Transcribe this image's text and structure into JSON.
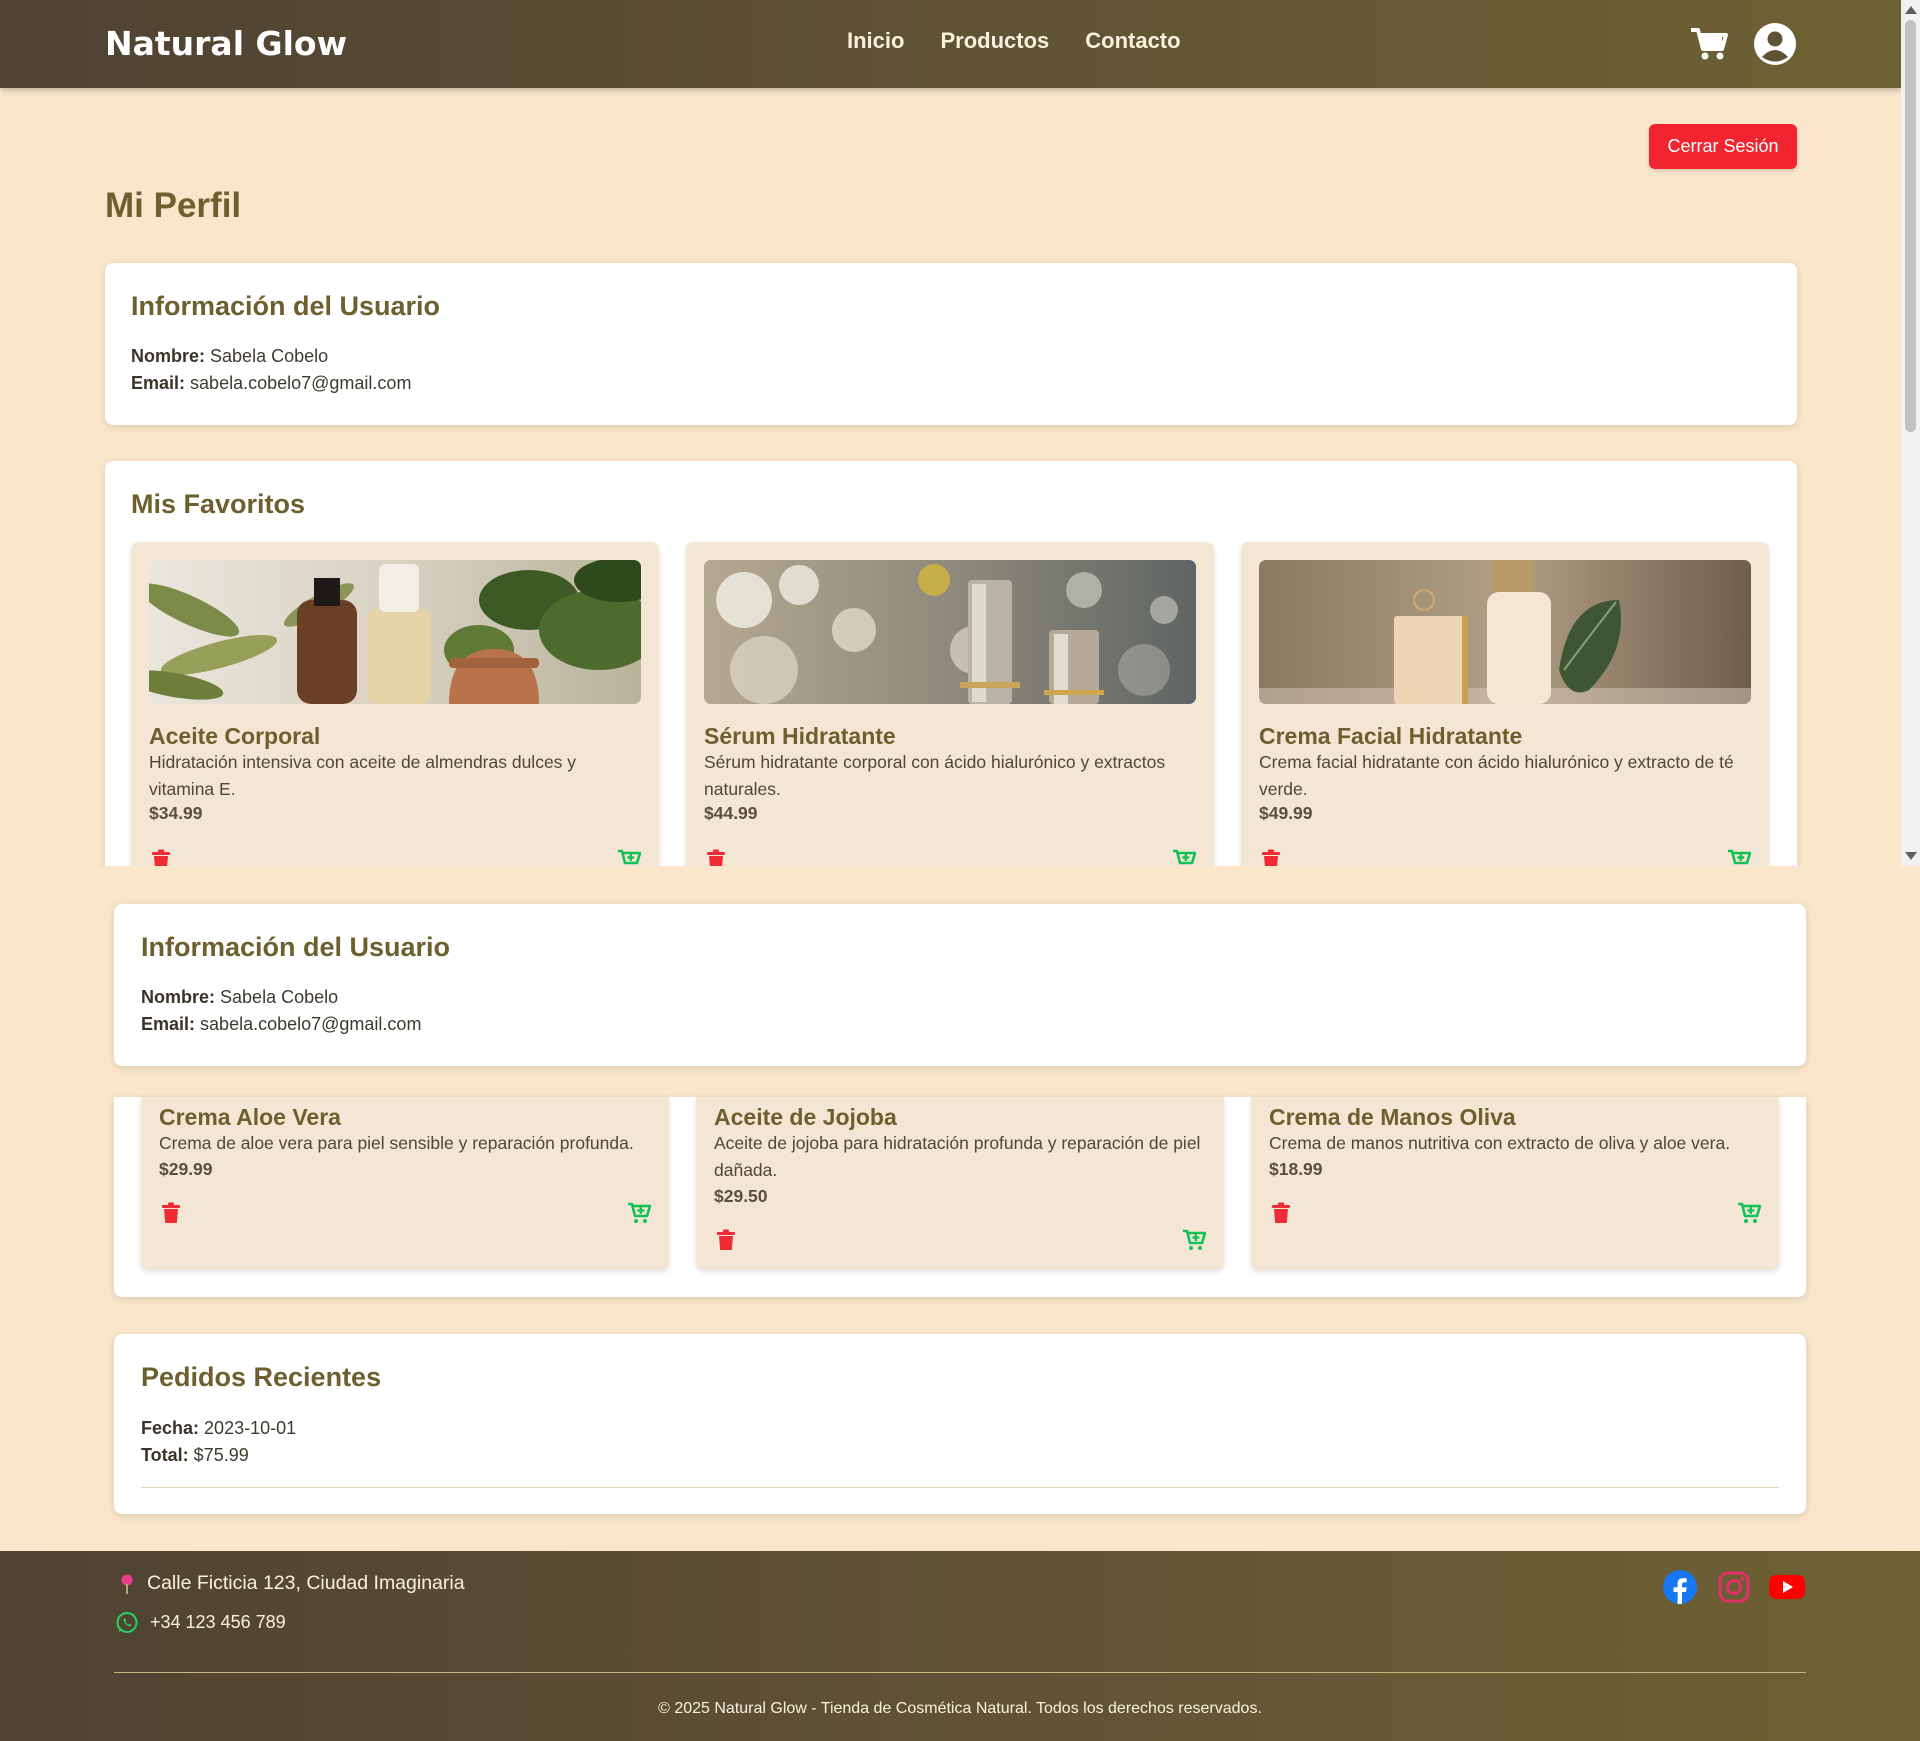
{
  "navbar": {
    "brand": "Natural Glow",
    "links": [
      "Inicio",
      "Productos",
      "Contacto"
    ],
    "icons": [
      "shopping-cart-icon",
      "user-circle-icon"
    ]
  },
  "logout_label": "Cerrar Sesión",
  "page_title": "Mi Perfil",
  "user_info": {
    "title": "Información del Usuario",
    "name_label": "Nombre:",
    "name": "Sabela Cobelo",
    "email_label": "Email:",
    "email": "sabela.cobelo7@gmail.com"
  },
  "favorites": {
    "title": "Mis Favoritos",
    "items": [
      {
        "name": "Aceite Corporal",
        "description": "Hidratación intensiva con aceite de almendras dulces y vitamina E.",
        "price": "$34.99"
      },
      {
        "name": "Sérum Hidratante",
        "description": "Sérum hidratante corporal con ácido hialurónico y extractos naturales.",
        "price": "$44.99"
      },
      {
        "name": "Crema Facial Hidratante",
        "description": "Crema facial hidratante con ácido hialurónico y extracto de té verde.",
        "price": "$49.99"
      },
      {
        "name": "Crema Aloe Vera",
        "description": "Crema de aloe vera para piel sensible y reparación profunda.",
        "price": "$29.99"
      },
      {
        "name": "Aceite de Jojoba",
        "description": "Aceite de jojoba para hidratación profunda y reparación de piel dañada.",
        "price": "$29.50"
      },
      {
        "name": "Crema de Manos Oliva",
        "description": "Crema de manos nutritiva con extracto de oliva y aloe vera.",
        "price": "$18.99"
      }
    ],
    "icons": [
      "trash-icon",
      "cart-plus-icon"
    ]
  },
  "orders": {
    "title": "Pedidos Recientes",
    "date_label": "Fecha:",
    "date": "2023-10-01",
    "total_label": "Total:",
    "total": "$75.99"
  },
  "footer": {
    "address": "Calle Ficticia 123, Ciudad Imaginaria",
    "phone": "+34 123 456 789",
    "social_icons": [
      "facebook-icon",
      "instagram-icon",
      "youtube-icon"
    ],
    "copyright": "© 2025 Natural Glow - Tienda de Cosmética Natural. Todos los derechos reservados."
  },
  "colors": {
    "background": "#f9e6cb",
    "header_dark": "#4e4232",
    "header_olive": "#6e6133",
    "title_olive": "#6e5f2e",
    "logout_red": "#f2242f",
    "trash_red": "#ef2b36",
    "cart_green": "#12c257",
    "favorite_card": "#f4e6d4"
  }
}
